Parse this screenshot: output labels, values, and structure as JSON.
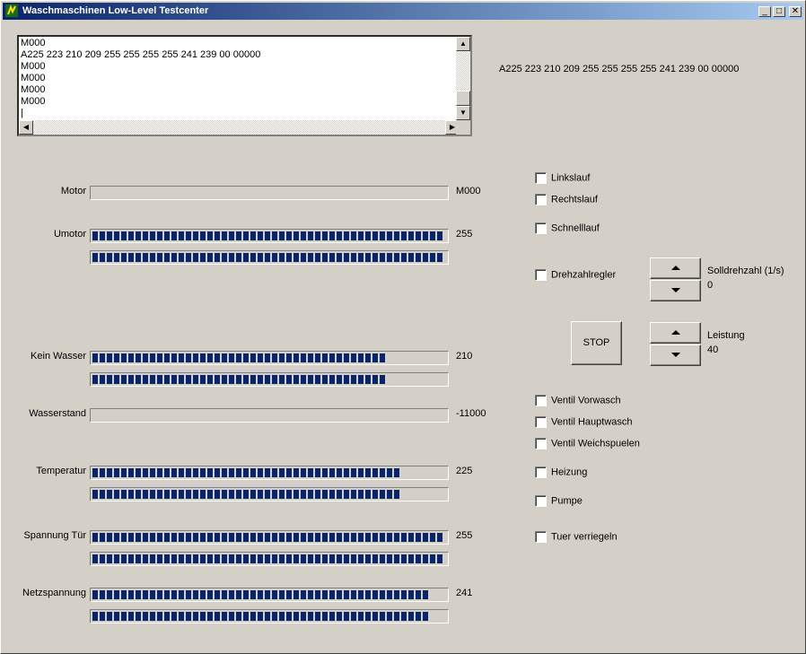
{
  "window": {
    "title": "Waschmaschinen Low-Level Testcenter",
    "min_label": "_",
    "max_label": "□",
    "close_label": "✕"
  },
  "log": {
    "lines": "M000\nA225 223 210 209 255 255 255 255 241 239 00 00000\nM000\nM000\nM000\nM000\n|"
  },
  "status_line": "A225 223 210 209 255 255 255 255 241 239 00 00000",
  "rows": {
    "motor": {
      "label": "Motor",
      "value": "M000",
      "fill": 0
    },
    "umotor": {
      "label": "Umotor",
      "value": "255",
      "fill1": 1.0,
      "fill2": 1.0
    },
    "kein_wasser": {
      "label": "Kein Wasser",
      "value": "210",
      "fill1": 0.83,
      "fill2": 0.83
    },
    "wasserstand": {
      "label": "Wasserstand",
      "value": "-11000",
      "fill": 0
    },
    "temperatur": {
      "label": "Temperatur",
      "value": "225",
      "fill1": 0.88,
      "fill2": 0.88
    },
    "spannung_tuer": {
      "label": "Spannung Tür",
      "value": "255",
      "fill1": 1.0,
      "fill2": 1.0
    },
    "netzspannung": {
      "label": "Netzspannung",
      "value": "241",
      "fill1": 0.95,
      "fill2": 0.95
    }
  },
  "checkboxes": {
    "linkslauf": "Linkslauf",
    "rechtslauf": "Rechtslauf",
    "schnelllauf": "Schnelllauf",
    "drehzahlregler": "Drehzahlregler",
    "ventil_vorwasch": "Ventil Vorwasch",
    "ventil_hauptwasch": "Ventil Hauptwasch",
    "ventil_weichspuelen": "Ventil Weichspuelen",
    "heizung": "Heizung",
    "pumpe": "Pumpe",
    "tuer_verriegeln": "Tuer verriegeln"
  },
  "controls": {
    "stop_label": "STOP",
    "solldrehzahl_label": "Solldrehzahl (1/s)",
    "solldrehzahl_value": "0",
    "leistung_label": "Leistung",
    "leistung_value": "40"
  }
}
